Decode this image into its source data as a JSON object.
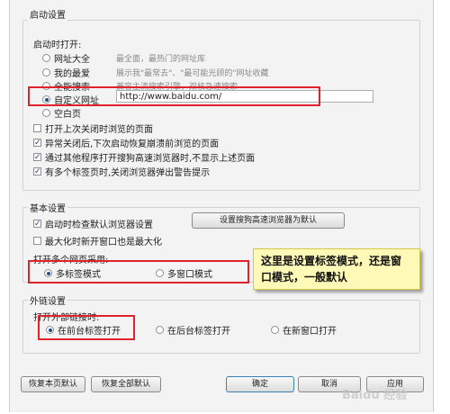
{
  "colors": {
    "highlight": "#e0222c",
    "callout_bg": "#fff9b8",
    "dialog_bg": "#f3f3f3"
  },
  "startup": {
    "title": "启动设置",
    "open_label": "启动时打开:",
    "options": [
      {
        "label": "网址大全",
        "desc": "最全面，最热门的网址库",
        "selected": false
      },
      {
        "label": "我的最爱",
        "desc": "展示我\"最常去\"、\"最可能光顾的\"网址收藏",
        "selected": false
      },
      {
        "label": "全能搜索",
        "desc": "兼容主流搜索引擎，双核急速搜索",
        "selected": false
      },
      {
        "label": "自定义网址",
        "desc": "",
        "selected": true
      },
      {
        "label": "空白页",
        "desc": "",
        "selected": false
      }
    ],
    "custom_url": "http://www.baidu.com/",
    "checks": [
      {
        "label": "打开上次关闭时浏览的页面",
        "checked": false
      },
      {
        "label": "异常关闭后,下次启动恢复崩溃前浏览的页面",
        "checked": true
      },
      {
        "label": "通过其他程序打开搜狗高速浏览器时,不显示上述页面",
        "checked": true
      },
      {
        "label": "有多个标签页时,关闭浏览器弹出警告提示",
        "checked": true
      }
    ]
  },
  "basic": {
    "title": "基本设置",
    "check_default": {
      "label": "启动时检查默认浏览器设置",
      "checked": true
    },
    "set_default_button": "设置搜狗高速浏览器为默认",
    "check_maximize": {
      "label": "最大化时新开窗口也是最大化",
      "checked": false
    },
    "multi_label": "打开多个网页采用:",
    "multi_options": [
      {
        "label": "多标签模式",
        "selected": true
      },
      {
        "label": "多窗口模式",
        "selected": false
      }
    ]
  },
  "external": {
    "title": "外链设置",
    "label": "打开外部链接时:",
    "options": [
      {
        "label": "在前台标签打开",
        "selected": true
      },
      {
        "label": "在后台标签打开",
        "selected": false
      },
      {
        "label": "在新窗口打开",
        "selected": false
      }
    ]
  },
  "callout": {
    "line1": "这里是设置标签模式，还是窗",
    "line2": "口模式，一般默认"
  },
  "footer": {
    "reset_page": "恢复本页默认",
    "reset_all": "恢复全部默认",
    "ok": "确定",
    "cancel": "取消",
    "apply": "应用"
  },
  "watermark": "Baidu 经验"
}
